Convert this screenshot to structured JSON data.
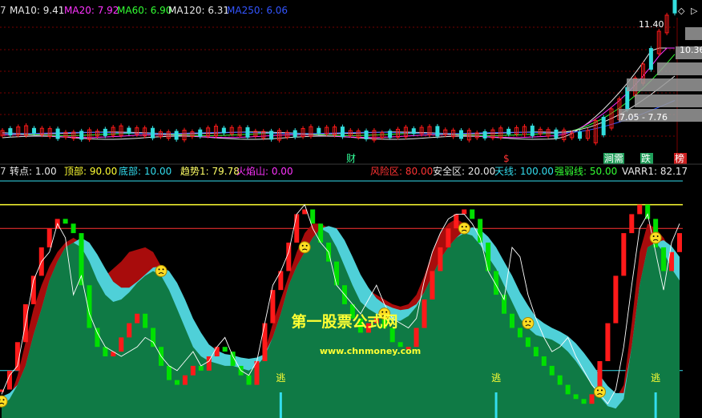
{
  "top_legend": [
    {
      "text": "7",
      "color": "#cccccc"
    },
    {
      "text": "MA10: 9.41",
      "color": "#e8e8e8"
    },
    {
      "text": "MA20: 7.92",
      "color": "#ff33ff"
    },
    {
      "text": "MA60: 6.90",
      "color": "#33ff33"
    },
    {
      "text": "MA120: 6.31",
      "color": "#e8e8e8"
    },
    {
      "text": "MA250: 6.06",
      "color": "#3355ff"
    }
  ],
  "price_labels": {
    "high": "11.40",
    "last": "10.36",
    "range": "7.05 - 7.76"
  },
  "event_markers": [
    {
      "text": "财",
      "color": "#33ff99",
      "bg": ""
    },
    {
      "text": "$",
      "color": "#ff3333",
      "bg": ""
    },
    {
      "text": "涧需",
      "color": "#ffffff",
      "bg": "#1f9f5a"
    },
    {
      "text": "跌",
      "color": "#ffffff",
      "bg": "#1f9f5a"
    },
    {
      "text": "榜",
      "color": "#ffffff",
      "bg": "#cc2020"
    }
  ],
  "bottom_legend": [
    {
      "text": "7",
      "color": "#cccccc"
    },
    {
      "text": "转点: 1.00",
      "color": "#e8e8e8"
    },
    {
      "text": "顶部: 90.00",
      "color": "#ffff33"
    },
    {
      "text": "底部: 10.00",
      "color": "#33ddee"
    },
    {
      "text": "趋势1: 79.78",
      "color": "#ffff66"
    },
    {
      "text": "火焰山: 0.00",
      "color": "#ff33ff"
    },
    {
      "text": "风险区: 80.00",
      "color": "#ff3333"
    },
    {
      "text": "安全区: 20.00",
      "color": "#e8e8e8"
    },
    {
      "text": "天线: 100.00",
      "color": "#33ddee"
    },
    {
      "text": "强弱线: 50.00",
      "color": "#33ff33"
    },
    {
      "text": "VARR1: 82.17",
      "color": "#e8e8e8"
    }
  ],
  "escape_label": "逃",
  "watermark": {
    "title": "第一股票公式网",
    "url": "www.chnmoney.com"
  },
  "colors": {
    "up": "#ff1a1a",
    "down": "#00e000",
    "fill_green": "#0f7a45",
    "fill_red": "#a80c0c",
    "cyan_band": "#4fd0d8",
    "risk": "#ff3333",
    "top_line": "#ffff33",
    "safe_line": "#33ddee"
  },
  "chart_data": [
    {
      "type": "line",
      "title": "",
      "series": [
        {
          "name": "MA10",
          "values": [
            9.41
          ]
        },
        {
          "name": "MA20",
          "values": [
            7.92
          ]
        },
        {
          "name": "MA60",
          "values": [
            6.9
          ]
        },
        {
          "name": "MA120",
          "values": [
            6.31
          ]
        },
        {
          "name": "MA250",
          "values": [
            6.06
          ]
        }
      ],
      "price_high": 11.4,
      "price_last": 10.36,
      "price_range": [
        7.05,
        7.76
      ],
      "grid": true
    },
    {
      "type": "area",
      "title": "",
      "ylim": [
        0,
        100
      ],
      "reference_lines": [
        {
          "name": "天线",
          "value": 100
        },
        {
          "name": "顶部",
          "value": 90
        },
        {
          "name": "风险区",
          "value": 80
        },
        {
          "name": "强弱线",
          "value": 50
        },
        {
          "name": "安全区",
          "value": 20
        },
        {
          "name": "底部",
          "value": 10
        }
      ],
      "x": [
        0,
        1,
        2,
        3,
        4,
        5,
        6,
        7,
        8,
        9,
        10,
        11,
        12,
        13,
        14,
        15,
        16,
        17,
        18,
        19,
        20,
        21,
        22,
        23,
        24,
        25,
        26,
        27,
        28,
        29,
        30,
        31,
        32,
        33,
        34,
        35,
        36,
        37,
        38,
        39,
        40,
        41,
        42,
        43,
        44,
        45,
        46,
        47,
        48,
        49,
        50,
        51,
        52,
        53,
        54,
        55,
        56,
        57,
        58,
        59,
        60,
        61,
        62,
        63,
        64,
        65,
        66,
        67,
        68,
        69,
        70,
        71,
        72,
        73,
        74,
        75,
        76,
        77,
        78,
        79,
        80,
        81,
        82,
        83,
        84,
        85
      ],
      "series": [
        {
          "name": "趋势1",
          "values": [
            5,
            8,
            14,
            22,
            35,
            46,
            58,
            66,
            72,
            74,
            72,
            66,
            58,
            52,
            49,
            50,
            53,
            57,
            60,
            62,
            60,
            54,
            46,
            38,
            30,
            26,
            24,
            23,
            22,
            22,
            21,
            20,
            22,
            26,
            34,
            44,
            56,
            64,
            70,
            76,
            80,
            78,
            72,
            64,
            56,
            49,
            46,
            44,
            42,
            41,
            41,
            43,
            47,
            53,
            60,
            67,
            72,
            76,
            78,
            77,
            73,
            68,
            63,
            56,
            49,
            42,
            38,
            35,
            34,
            33,
            31,
            28,
            24,
            19,
            14,
            9,
            5,
            4,
            8,
            30,
            56,
            72,
            74,
            70,
            63,
            58
          ]
        },
        {
          "name": "火焰山",
          "values": [
            5,
            8,
            18,
            32,
            46,
            56,
            64,
            70,
            74,
            76,
            74,
            70,
            64,
            60,
            63,
            66,
            70,
            71,
            72,
            70,
            64,
            56,
            46,
            38,
            30,
            26,
            24,
            23,
            22,
            22,
            21,
            20,
            22,
            28,
            40,
            50,
            60,
            70,
            78,
            82,
            82,
            80,
            74,
            66,
            60,
            56,
            54,
            52,
            50,
            48,
            47,
            48,
            52,
            60,
            70,
            78,
            82,
            84,
            82,
            80,
            76,
            70,
            66,
            62,
            58,
            50,
            42,
            36,
            33,
            32,
            30,
            26,
            22,
            18,
            14,
            10,
            6,
            8,
            14,
            40,
            70,
            82,
            80,
            76,
            70,
            62
          ]
        },
        {
          "name": "VARR1",
          "values": [
            10,
            18,
            22,
            40,
            58,
            66,
            70,
            82,
            76,
            52,
            60,
            44,
            36,
            30,
            28,
            26,
            28,
            30,
            34,
            32,
            26,
            22,
            20,
            24,
            28,
            22,
            24,
            30,
            34,
            26,
            20,
            18,
            24,
            40,
            56,
            62,
            70,
            86,
            90,
            80,
            74,
            70,
            56,
            52,
            48,
            44,
            50,
            56,
            48,
            42,
            40,
            38,
            42,
            58,
            70,
            78,
            84,
            86,
            86,
            82,
            76,
            62,
            56,
            50,
            72,
            68,
            52,
            42,
            34,
            28,
            30,
            34,
            26,
            20,
            14,
            10,
            6,
            12,
            30,
            56,
            80,
            86,
            70,
            54,
            74,
            82
          ]
        },
        {
          "name": "转点",
          "values": [
            12,
            20,
            32,
            48,
            60,
            72,
            80,
            84,
            82,
            78,
            56,
            38,
            30,
            26,
            28,
            34,
            40,
            44,
            38,
            30,
            22,
            16,
            14,
            18,
            22,
            20,
            26,
            30,
            28,
            22,
            18,
            14,
            24,
            40,
            54,
            62,
            74,
            86,
            88,
            82,
            74,
            66,
            56,
            48,
            42,
            36,
            40,
            42,
            38,
            32,
            30,
            30,
            38,
            50,
            62,
            72,
            80,
            86,
            88,
            84,
            74,
            62,
            52,
            44,
            38,
            34,
            30,
            26,
            22,
            18,
            14,
            10,
            8,
            6,
            10,
            24,
            40,
            60,
            78,
            86,
            90,
            84,
            72,
            62,
            70,
            78
          ]
        }
      ],
      "markers": {
        "smiley_x": [
          0,
          20,
          38,
          48,
          58,
          66,
          75,
          82
        ],
        "escape_x": [
          35,
          62,
          82
        ]
      }
    }
  ]
}
